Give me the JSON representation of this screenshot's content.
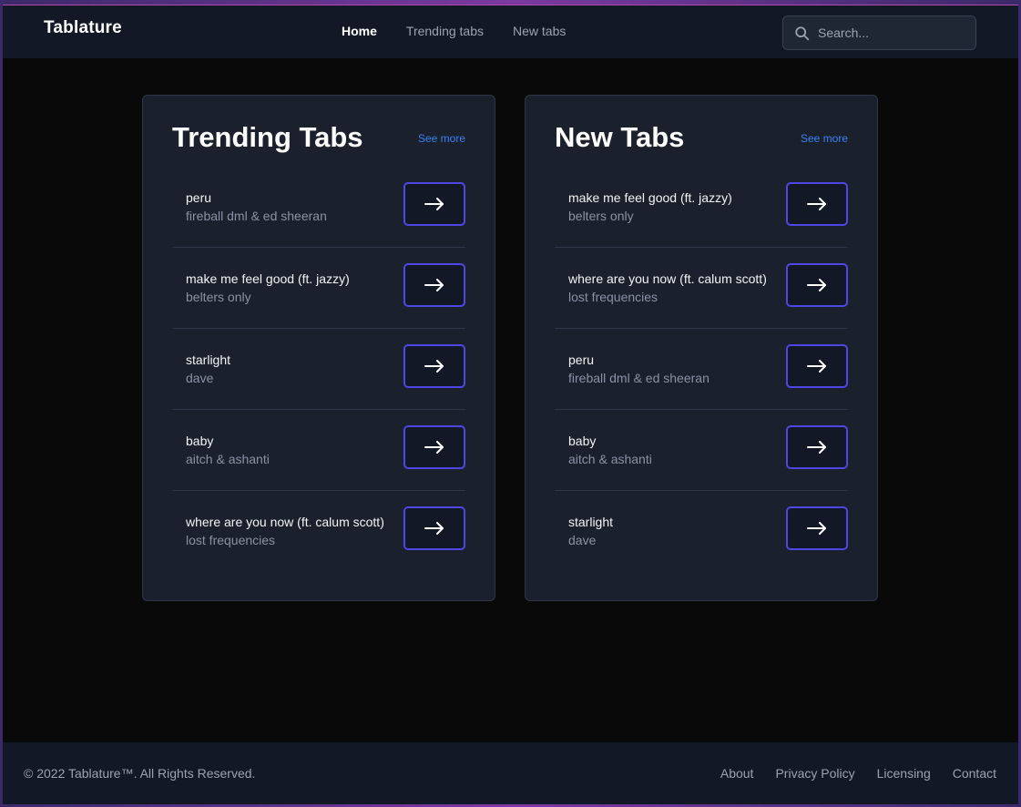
{
  "header": {
    "brand": "Tablature",
    "nav": [
      {
        "label": "Home",
        "active": true
      },
      {
        "label": "Trending tabs",
        "active": false
      },
      {
        "label": "New tabs",
        "active": false
      }
    ],
    "search": {
      "placeholder": "Search...",
      "value": "",
      "icon": "search-icon"
    }
  },
  "trending": {
    "title": "Trending Tabs",
    "see_more": "See more",
    "items": [
      {
        "title": "peru",
        "artist": "fireball dml & ed sheeran"
      },
      {
        "title": "make me feel good (ft. jazzy)",
        "artist": "belters only"
      },
      {
        "title": "starlight",
        "artist": "dave"
      },
      {
        "title": "baby",
        "artist": "aitch & ashanti"
      },
      {
        "title": "where are you now (ft. calum scott)",
        "artist": "lost frequencies"
      }
    ]
  },
  "new": {
    "title": "New Tabs",
    "see_more": "See more",
    "items": [
      {
        "title": "make me feel good (ft. jazzy)",
        "artist": "belters only"
      },
      {
        "title": "where are you now (ft. calum scott)",
        "artist": "lost frequencies"
      },
      {
        "title": "peru",
        "artist": "fireball dml & ed sheeran"
      },
      {
        "title": "baby",
        "artist": "aitch & ashanti"
      },
      {
        "title": "starlight",
        "artist": "dave"
      }
    ]
  },
  "footer": {
    "copyright": "© 2022 Tablature™. All Rights Reserved.",
    "links": [
      "About",
      "Privacy Policy",
      "Licensing",
      "Contact"
    ]
  },
  "colors": {
    "accent": "#4f46e5",
    "link": "#3b82f6",
    "card_bg": "#1a202c",
    "page_bg": "#09090a"
  }
}
